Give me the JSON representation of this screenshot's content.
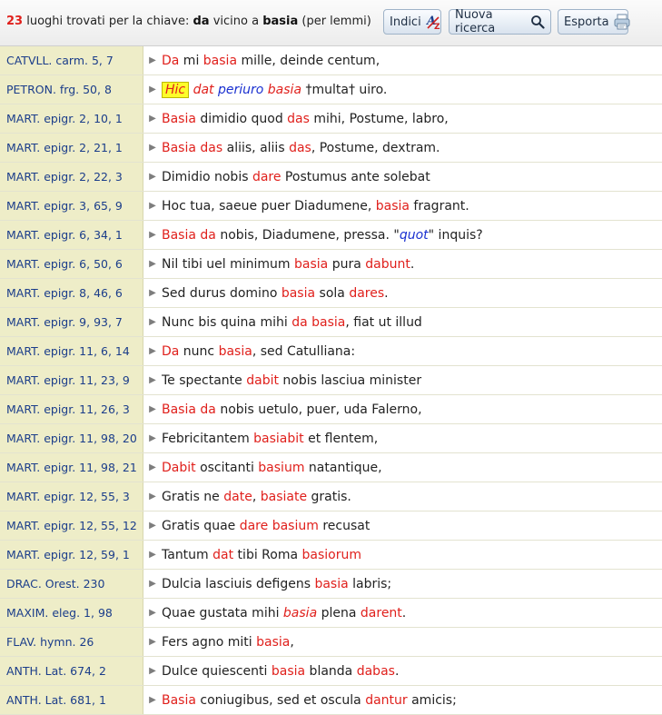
{
  "header": {
    "count": "23",
    "text1": " luoghi trovati per la chiave: ",
    "key1": "da",
    "text2": " vicino a ",
    "key2": "basia",
    "text3": " (per lemmi)"
  },
  "buttons": {
    "indici": "Indici",
    "nuova": "Nuova ricerca",
    "esporta": "Esporta"
  },
  "colors": {
    "match": "#e0201c",
    "alt": "#1a30d0",
    "ref": "#1b3d8a",
    "ref_bg": "#eeedc8"
  },
  "rows": [
    {
      "ref": "CATVLL. carm. 5, 7",
      "tokens": [
        [
          "red",
          "Da"
        ],
        [
          "plain",
          " mi "
        ],
        [
          "red",
          "basia"
        ],
        [
          "plain",
          " mille, deinde centum,"
        ]
      ]
    },
    {
      "ref": "PETRON. frg. 50, 8",
      "tokens": [
        [
          "hl",
          "Hic"
        ],
        [
          "plain",
          " "
        ],
        [
          "red-i",
          "dat"
        ],
        [
          "plain",
          " "
        ],
        [
          "blue-i",
          "periuro"
        ],
        [
          "plain",
          " "
        ],
        [
          "red-i",
          "basia"
        ],
        [
          "plain",
          " †multa† uiro."
        ]
      ]
    },
    {
      "ref": "MART. epigr. 2, 10, 1",
      "tokens": [
        [
          "red",
          "Basia"
        ],
        [
          "plain",
          " dimidio quod "
        ],
        [
          "red",
          "das"
        ],
        [
          "plain",
          " mihi, Postume, labro,"
        ]
      ]
    },
    {
      "ref": "MART. epigr. 2, 21, 1",
      "tokens": [
        [
          "red",
          "Basia"
        ],
        [
          "plain",
          " "
        ],
        [
          "red",
          "das"
        ],
        [
          "plain",
          " aliis, aliis "
        ],
        [
          "red",
          "das"
        ],
        [
          "plain",
          ", Postume, dextram."
        ]
      ]
    },
    {
      "ref": "MART. epigr. 2, 22, 3",
      "tokens": [
        [
          "plain",
          "Dimidio nobis "
        ],
        [
          "red",
          "dare"
        ],
        [
          "plain",
          " Postumus ante solebat"
        ]
      ]
    },
    {
      "ref": "MART. epigr. 3, 65, 9",
      "tokens": [
        [
          "plain",
          "Hoc tua, saeue puer Diadumene, "
        ],
        [
          "red",
          "basia"
        ],
        [
          "plain",
          " fragrant."
        ]
      ]
    },
    {
      "ref": "MART. epigr. 6, 34, 1",
      "tokens": [
        [
          "red",
          "Basia"
        ],
        [
          "plain",
          " "
        ],
        [
          "red",
          "da"
        ],
        [
          "plain",
          " nobis, Diadumene, pressa. \""
        ],
        [
          "blue-i",
          "quot"
        ],
        [
          "plain",
          "\" inquis?"
        ]
      ]
    },
    {
      "ref": "MART. epigr. 6, 50, 6",
      "tokens": [
        [
          "plain",
          "Nil tibi uel minimum "
        ],
        [
          "red",
          "basia"
        ],
        [
          "plain",
          " pura "
        ],
        [
          "red",
          "dabunt"
        ],
        [
          "plain",
          "."
        ]
      ]
    },
    {
      "ref": "MART. epigr. 8, 46, 6",
      "tokens": [
        [
          "plain",
          "Sed durus domino "
        ],
        [
          "red",
          "basia"
        ],
        [
          "plain",
          " sola "
        ],
        [
          "red",
          "dares"
        ],
        [
          "plain",
          "."
        ]
      ]
    },
    {
      "ref": "MART. epigr. 9, 93, 7",
      "tokens": [
        [
          "plain",
          "Nunc bis quina mihi "
        ],
        [
          "red",
          "da"
        ],
        [
          "plain",
          " "
        ],
        [
          "red",
          "basia"
        ],
        [
          "plain",
          ", fiat ut illud"
        ]
      ]
    },
    {
      "ref": "MART. epigr. 11, 6, 14",
      "tokens": [
        [
          "red",
          "Da"
        ],
        [
          "plain",
          " nunc "
        ],
        [
          "red",
          "basia"
        ],
        [
          "plain",
          ", sed Catulliana:"
        ]
      ]
    },
    {
      "ref": "MART. epigr. 11, 23, 9",
      "tokens": [
        [
          "plain",
          "Te spectante "
        ],
        [
          "red",
          "dabit"
        ],
        [
          "plain",
          " nobis lasciua minister"
        ]
      ]
    },
    {
      "ref": "MART. epigr. 11, 26, 3",
      "tokens": [
        [
          "red",
          "Basia"
        ],
        [
          "plain",
          " "
        ],
        [
          "red",
          "da"
        ],
        [
          "plain",
          " nobis uetulo, puer, uda Falerno,"
        ]
      ]
    },
    {
      "ref": "MART. epigr. 11, 98, 20",
      "tokens": [
        [
          "plain",
          "Febricitantem "
        ],
        [
          "red",
          "basiabit"
        ],
        [
          "plain",
          " et flentem,"
        ]
      ]
    },
    {
      "ref": "MART. epigr. 11, 98, 21",
      "tokens": [
        [
          "red",
          "Dabit"
        ],
        [
          "plain",
          " oscitanti "
        ],
        [
          "red",
          "basium"
        ],
        [
          "plain",
          " natantique,"
        ]
      ]
    },
    {
      "ref": "MART. epigr. 12, 55, 3",
      "tokens": [
        [
          "plain",
          "Gratis ne "
        ],
        [
          "red",
          "date"
        ],
        [
          "plain",
          ", "
        ],
        [
          "red",
          "basiate"
        ],
        [
          "plain",
          " gratis."
        ]
      ]
    },
    {
      "ref": "MART. epigr. 12, 55, 12",
      "tokens": [
        [
          "plain",
          "Gratis quae "
        ],
        [
          "red",
          "dare"
        ],
        [
          "plain",
          " "
        ],
        [
          "red",
          "basium"
        ],
        [
          "plain",
          " recusat"
        ]
      ]
    },
    {
      "ref": "MART. epigr. 12, 59, 1",
      "tokens": [
        [
          "plain",
          "Tantum "
        ],
        [
          "red",
          "dat"
        ],
        [
          "plain",
          " tibi Roma "
        ],
        [
          "red",
          "basiorum"
        ]
      ]
    },
    {
      "ref": "DRAC. Orest. 230",
      "tokens": [
        [
          "plain",
          "Dulcia lasciuis defigens "
        ],
        [
          "red",
          "basia"
        ],
        [
          "plain",
          " labris;"
        ]
      ]
    },
    {
      "ref": "MAXIM. eleg. 1, 98",
      "tokens": [
        [
          "plain",
          "Quae gustata mihi "
        ],
        [
          "red-i",
          "basia"
        ],
        [
          "plain",
          " plena "
        ],
        [
          "red",
          "darent"
        ],
        [
          "plain",
          "."
        ]
      ]
    },
    {
      "ref": "FLAV. hymn. 26",
      "tokens": [
        [
          "plain",
          "Fers agno miti "
        ],
        [
          "red",
          "basia"
        ],
        [
          "plain",
          ","
        ]
      ]
    },
    {
      "ref": "ANTH. Lat. 674, 2",
      "tokens": [
        [
          "plain",
          "Dulce quiescenti "
        ],
        [
          "red",
          "basia"
        ],
        [
          "plain",
          " blanda "
        ],
        [
          "red",
          "dabas"
        ],
        [
          "plain",
          "."
        ]
      ]
    },
    {
      "ref": "ANTH. Lat. 681, 1",
      "tokens": [
        [
          "red",
          "Basia"
        ],
        [
          "plain",
          " coniugibus, sed et oscula "
        ],
        [
          "red",
          "dantur"
        ],
        [
          "plain",
          " amicis;"
        ]
      ]
    }
  ]
}
